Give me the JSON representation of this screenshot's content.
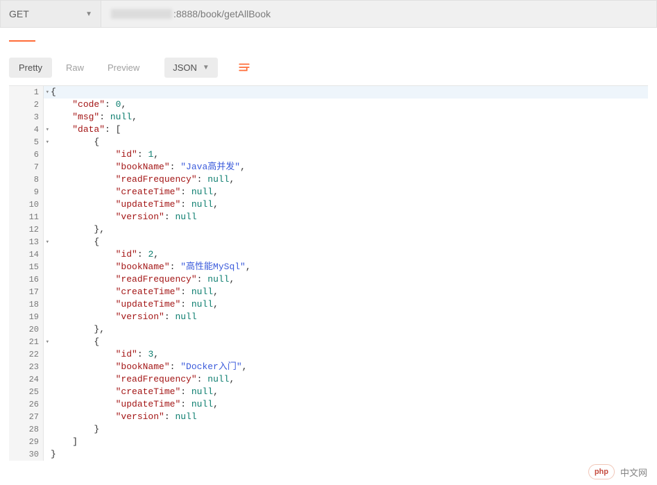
{
  "request": {
    "method": "GET",
    "url_suffix": ":8888/book/getAllBook"
  },
  "viewTabs": {
    "pretty": "Pretty",
    "raw": "Raw",
    "preview": "Preview"
  },
  "formatSelect": {
    "label": "JSON"
  },
  "response": {
    "code": 0,
    "msg": null,
    "data": [
      {
        "id": 1,
        "bookName": "Java高并发",
        "readFrequency": null,
        "createTime": null,
        "updateTime": null,
        "version": null
      },
      {
        "id": 2,
        "bookName": "高性能MySql",
        "readFrequency": null,
        "createTime": null,
        "updateTime": null,
        "version": null
      },
      {
        "id": 3,
        "bookName": "Docker入门",
        "readFrequency": null,
        "createTime": null,
        "updateTime": null,
        "version": null
      }
    ]
  },
  "codeLines": [
    {
      "n": 1,
      "fold": true,
      "hl": true,
      "indent": 0,
      "tokens": [
        {
          "t": "punc",
          "v": "{"
        }
      ]
    },
    {
      "n": 2,
      "fold": false,
      "hl": false,
      "indent": 1,
      "tokens": [
        {
          "t": "key",
          "v": "\"code\""
        },
        {
          "t": "punc",
          "v": ": "
        },
        {
          "t": "num",
          "v": "0"
        },
        {
          "t": "punc",
          "v": ","
        }
      ]
    },
    {
      "n": 3,
      "fold": false,
      "hl": false,
      "indent": 1,
      "tokens": [
        {
          "t": "key",
          "v": "\"msg\""
        },
        {
          "t": "punc",
          "v": ": "
        },
        {
          "t": "null",
          "v": "null"
        },
        {
          "t": "punc",
          "v": ","
        }
      ]
    },
    {
      "n": 4,
      "fold": true,
      "hl": false,
      "indent": 1,
      "tokens": [
        {
          "t": "key",
          "v": "\"data\""
        },
        {
          "t": "punc",
          "v": ": ["
        }
      ]
    },
    {
      "n": 5,
      "fold": true,
      "hl": false,
      "indent": 2,
      "tokens": [
        {
          "t": "punc",
          "v": "{"
        }
      ]
    },
    {
      "n": 6,
      "fold": false,
      "hl": false,
      "indent": 3,
      "tokens": [
        {
          "t": "key",
          "v": "\"id\""
        },
        {
          "t": "punc",
          "v": ": "
        },
        {
          "t": "num",
          "v": "1"
        },
        {
          "t": "punc",
          "v": ","
        }
      ]
    },
    {
      "n": 7,
      "fold": false,
      "hl": false,
      "indent": 3,
      "tokens": [
        {
          "t": "key",
          "v": "\"bookName\""
        },
        {
          "t": "punc",
          "v": ": "
        },
        {
          "t": "str",
          "v": "\"Java高并发\""
        },
        {
          "t": "punc",
          "v": ","
        }
      ]
    },
    {
      "n": 8,
      "fold": false,
      "hl": false,
      "indent": 3,
      "tokens": [
        {
          "t": "key",
          "v": "\"readFrequency\""
        },
        {
          "t": "punc",
          "v": ": "
        },
        {
          "t": "null",
          "v": "null"
        },
        {
          "t": "punc",
          "v": ","
        }
      ]
    },
    {
      "n": 9,
      "fold": false,
      "hl": false,
      "indent": 3,
      "tokens": [
        {
          "t": "key",
          "v": "\"createTime\""
        },
        {
          "t": "punc",
          "v": ": "
        },
        {
          "t": "null",
          "v": "null"
        },
        {
          "t": "punc",
          "v": ","
        }
      ]
    },
    {
      "n": 10,
      "fold": false,
      "hl": false,
      "indent": 3,
      "tokens": [
        {
          "t": "key",
          "v": "\"updateTime\""
        },
        {
          "t": "punc",
          "v": ": "
        },
        {
          "t": "null",
          "v": "null"
        },
        {
          "t": "punc",
          "v": ","
        }
      ]
    },
    {
      "n": 11,
      "fold": false,
      "hl": false,
      "indent": 3,
      "tokens": [
        {
          "t": "key",
          "v": "\"version\""
        },
        {
          "t": "punc",
          "v": ": "
        },
        {
          "t": "null",
          "v": "null"
        }
      ]
    },
    {
      "n": 12,
      "fold": false,
      "hl": false,
      "indent": 2,
      "tokens": [
        {
          "t": "punc",
          "v": "},"
        }
      ]
    },
    {
      "n": 13,
      "fold": true,
      "hl": false,
      "indent": 2,
      "tokens": [
        {
          "t": "punc",
          "v": "{"
        }
      ]
    },
    {
      "n": 14,
      "fold": false,
      "hl": false,
      "indent": 3,
      "tokens": [
        {
          "t": "key",
          "v": "\"id\""
        },
        {
          "t": "punc",
          "v": ": "
        },
        {
          "t": "num",
          "v": "2"
        },
        {
          "t": "punc",
          "v": ","
        }
      ]
    },
    {
      "n": 15,
      "fold": false,
      "hl": false,
      "indent": 3,
      "tokens": [
        {
          "t": "key",
          "v": "\"bookName\""
        },
        {
          "t": "punc",
          "v": ": "
        },
        {
          "t": "str",
          "v": "\"高性能MySql\""
        },
        {
          "t": "punc",
          "v": ","
        }
      ]
    },
    {
      "n": 16,
      "fold": false,
      "hl": false,
      "indent": 3,
      "tokens": [
        {
          "t": "key",
          "v": "\"readFrequency\""
        },
        {
          "t": "punc",
          "v": ": "
        },
        {
          "t": "null",
          "v": "null"
        },
        {
          "t": "punc",
          "v": ","
        }
      ]
    },
    {
      "n": 17,
      "fold": false,
      "hl": false,
      "indent": 3,
      "tokens": [
        {
          "t": "key",
          "v": "\"createTime\""
        },
        {
          "t": "punc",
          "v": ": "
        },
        {
          "t": "null",
          "v": "null"
        },
        {
          "t": "punc",
          "v": ","
        }
      ]
    },
    {
      "n": 18,
      "fold": false,
      "hl": false,
      "indent": 3,
      "tokens": [
        {
          "t": "key",
          "v": "\"updateTime\""
        },
        {
          "t": "punc",
          "v": ": "
        },
        {
          "t": "null",
          "v": "null"
        },
        {
          "t": "punc",
          "v": ","
        }
      ]
    },
    {
      "n": 19,
      "fold": false,
      "hl": false,
      "indent": 3,
      "tokens": [
        {
          "t": "key",
          "v": "\"version\""
        },
        {
          "t": "punc",
          "v": ": "
        },
        {
          "t": "null",
          "v": "null"
        }
      ]
    },
    {
      "n": 20,
      "fold": false,
      "hl": false,
      "indent": 2,
      "tokens": [
        {
          "t": "punc",
          "v": "},"
        }
      ]
    },
    {
      "n": 21,
      "fold": true,
      "hl": false,
      "indent": 2,
      "tokens": [
        {
          "t": "punc",
          "v": "{"
        }
      ]
    },
    {
      "n": 22,
      "fold": false,
      "hl": false,
      "indent": 3,
      "tokens": [
        {
          "t": "key",
          "v": "\"id\""
        },
        {
          "t": "punc",
          "v": ": "
        },
        {
          "t": "num",
          "v": "3"
        },
        {
          "t": "punc",
          "v": ","
        }
      ]
    },
    {
      "n": 23,
      "fold": false,
      "hl": false,
      "indent": 3,
      "tokens": [
        {
          "t": "key",
          "v": "\"bookName\""
        },
        {
          "t": "punc",
          "v": ": "
        },
        {
          "t": "str",
          "v": "\"Docker入门\""
        },
        {
          "t": "punc",
          "v": ","
        }
      ]
    },
    {
      "n": 24,
      "fold": false,
      "hl": false,
      "indent": 3,
      "tokens": [
        {
          "t": "key",
          "v": "\"readFrequency\""
        },
        {
          "t": "punc",
          "v": ": "
        },
        {
          "t": "null",
          "v": "null"
        },
        {
          "t": "punc",
          "v": ","
        }
      ]
    },
    {
      "n": 25,
      "fold": false,
      "hl": false,
      "indent": 3,
      "tokens": [
        {
          "t": "key",
          "v": "\"createTime\""
        },
        {
          "t": "punc",
          "v": ": "
        },
        {
          "t": "null",
          "v": "null"
        },
        {
          "t": "punc",
          "v": ","
        }
      ]
    },
    {
      "n": 26,
      "fold": false,
      "hl": false,
      "indent": 3,
      "tokens": [
        {
          "t": "key",
          "v": "\"updateTime\""
        },
        {
          "t": "punc",
          "v": ": "
        },
        {
          "t": "null",
          "v": "null"
        },
        {
          "t": "punc",
          "v": ","
        }
      ]
    },
    {
      "n": 27,
      "fold": false,
      "hl": false,
      "indent": 3,
      "tokens": [
        {
          "t": "key",
          "v": "\"version\""
        },
        {
          "t": "punc",
          "v": ": "
        },
        {
          "t": "null",
          "v": "null"
        }
      ]
    },
    {
      "n": 28,
      "fold": false,
      "hl": false,
      "indent": 2,
      "tokens": [
        {
          "t": "punc",
          "v": "}"
        }
      ]
    },
    {
      "n": 29,
      "fold": false,
      "hl": false,
      "indent": 1,
      "tokens": [
        {
          "t": "punc",
          "v": "]"
        }
      ]
    },
    {
      "n": 30,
      "fold": false,
      "hl": false,
      "indent": 0,
      "tokens": [
        {
          "t": "punc",
          "v": "}"
        }
      ]
    }
  ],
  "watermark": {
    "bubble": "php",
    "text": "中文网"
  }
}
